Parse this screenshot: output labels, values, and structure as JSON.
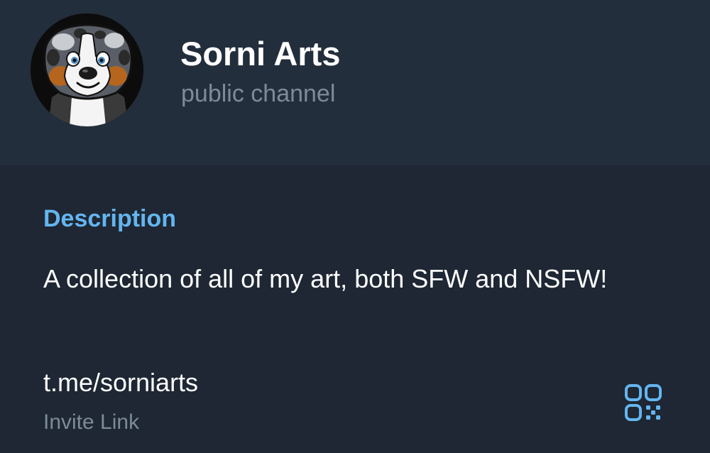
{
  "channel": {
    "name": "Sorni Arts",
    "type": "public channel",
    "avatar_icon": "husky-dog-avatar"
  },
  "info": {
    "description_title": "Description",
    "description": "A collection of all of my art, both SFW and NSFW!",
    "link": "t.me/sorniarts",
    "link_label": "Invite Link",
    "qr_icon": "qr-code-icon"
  },
  "colors": {
    "header_bg": "#232e3c",
    "body_bg": "#1e2733",
    "accent": "#64b5ef",
    "muted_text": "#7d8b99",
    "text": "#ffffff"
  }
}
